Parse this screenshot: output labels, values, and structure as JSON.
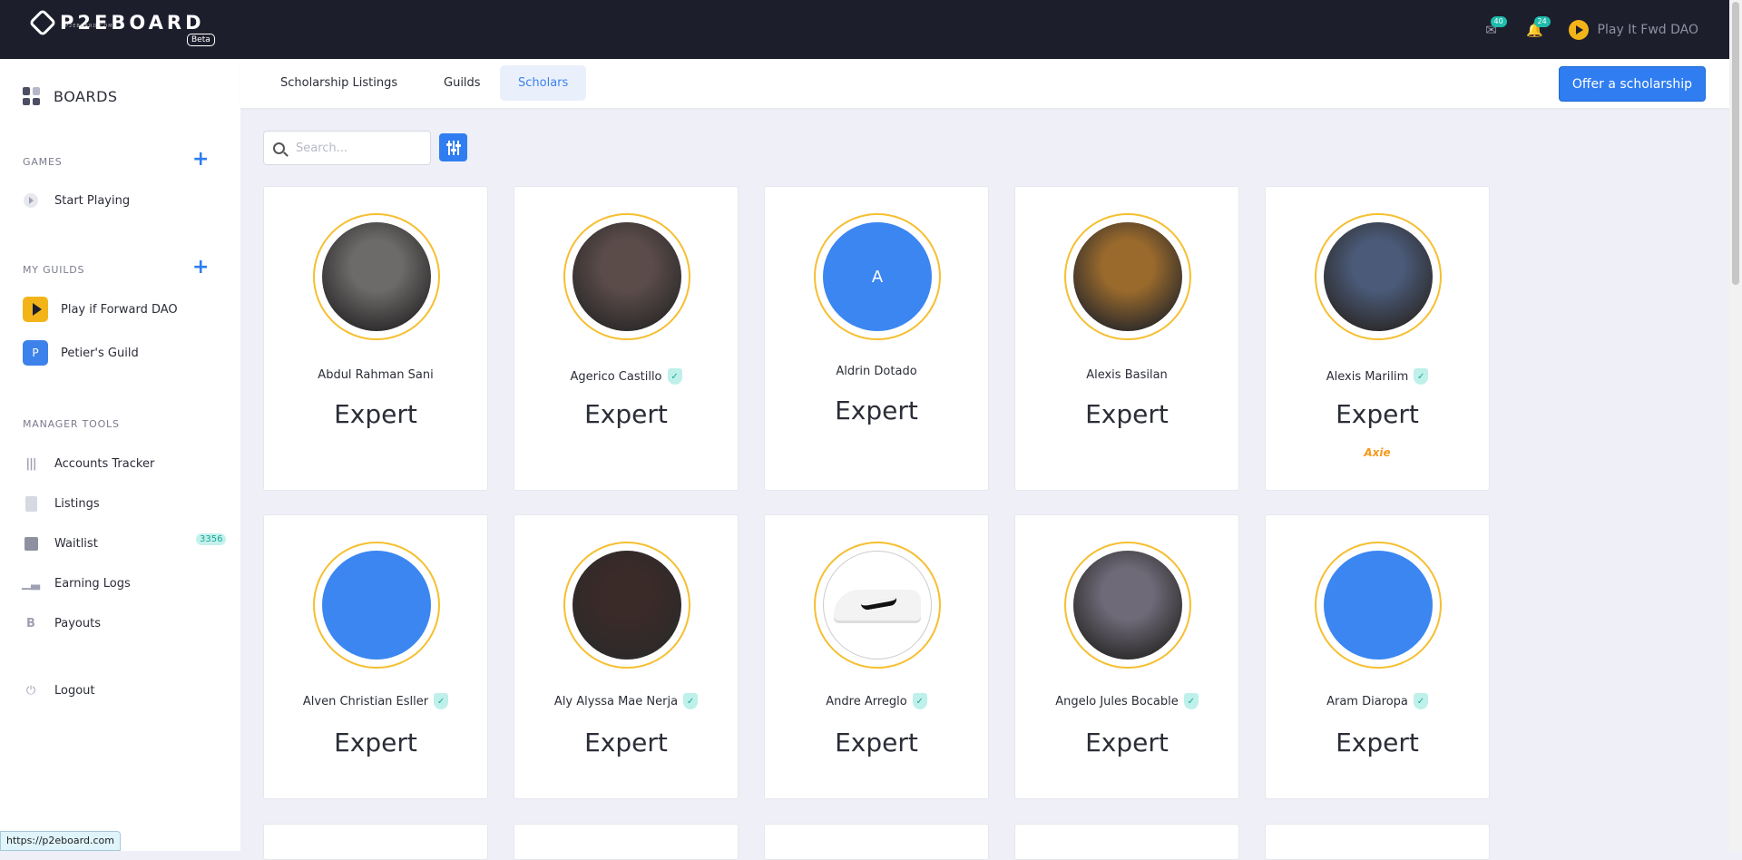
{
  "brand": {
    "name": "P2EBOARD",
    "subtitle": "P2EBOARD.COM",
    "badge": "Beta"
  },
  "topbar": {
    "mail_count": "40",
    "notif_count": "24",
    "guild_name": "Play It Fwd DAO",
    "mail_icon": "mail-icon",
    "bell_icon": "bell-icon"
  },
  "sidebar": {
    "boards_label": "BOARDS",
    "games_label": "GAMES",
    "games_items": [
      {
        "label": "Start Playing",
        "icon": "play-circle-icon"
      }
    ],
    "guilds_label": "MY GUILDS",
    "guilds": [
      {
        "label": "Play if Forward DAO",
        "icon_text": "",
        "color": "#f3b41a"
      },
      {
        "label": "Petier's Guild",
        "icon_text": "P",
        "color": "#3d82ea"
      }
    ],
    "tools_label": "MANAGER TOOLS",
    "tools": [
      {
        "label": "Accounts Tracker",
        "icon": "books-icon"
      },
      {
        "label": "Listings",
        "icon": "clipboard-icon"
      },
      {
        "label": "Waitlist",
        "icon": "user-badge-icon",
        "badge": "3356"
      },
      {
        "label": "Earning Logs",
        "icon": "bar-chart-icon"
      },
      {
        "label": "Payouts",
        "icon": "b-icon"
      }
    ],
    "logout_label": "Logout"
  },
  "tabs": [
    {
      "label": "Scholarship Listings",
      "active": false
    },
    {
      "label": "Guilds",
      "active": false
    },
    {
      "label": "Scholars",
      "active": true
    }
  ],
  "offer_button": "Offer a scholarship",
  "search": {
    "placeholder": "Search..."
  },
  "status_url": "https://p2eboard.com",
  "accent": "#2f7df0",
  "scholars": [
    {
      "name": "Abdul Rahman Sani",
      "level": "Expert",
      "verified": false,
      "avatar": "photo",
      "bg": "#6d6a6a"
    },
    {
      "name": "Agerico Castillo",
      "level": "Expert",
      "verified": true,
      "avatar": "photo",
      "bg": "#5b4c4a"
    },
    {
      "name": "Aldrin Dotado",
      "level": "Expert",
      "verified": false,
      "avatar": "initial",
      "initial": "A",
      "bg": "#3b86f0"
    },
    {
      "name": "Alexis Basilan",
      "level": "Expert",
      "verified": false,
      "avatar": "photo",
      "bg": "#9a6a2c"
    },
    {
      "name": "Alexis Marilim",
      "level": "Expert",
      "verified": true,
      "avatar": "photo",
      "bg": "#4a5a78",
      "game": "Axie"
    },
    {
      "name": "Alven Christian Esller",
      "level": "Expert",
      "verified": true,
      "avatar": "blank",
      "bg": "#3b86f0"
    },
    {
      "name": "Aly Alyssa Mae Nerja",
      "level": "Expert",
      "verified": true,
      "avatar": "photo",
      "bg": "#3a2a28"
    },
    {
      "name": "Andre Arreglo",
      "level": "Expert",
      "verified": true,
      "avatar": "sneaker",
      "bg": "#ffffff"
    },
    {
      "name": "Angelo Jules Bocable",
      "level": "Expert",
      "verified": true,
      "avatar": "photo",
      "bg": "#6e6a78"
    },
    {
      "name": "Aram Diaropa",
      "level": "Expert",
      "verified": true,
      "avatar": "blank",
      "bg": "#3b86f0"
    }
  ]
}
